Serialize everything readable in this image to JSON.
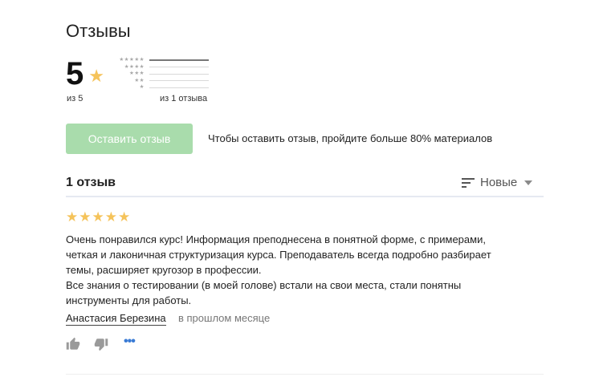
{
  "header": {
    "title": "Отзывы"
  },
  "summary": {
    "rating": "5",
    "star_glyph": "★",
    "out_of": "из 5",
    "count_text": "из 1 отзыва",
    "distribution": [
      {
        "stars": "★★★★★",
        "fraction": 1.0
      },
      {
        "stars": "★★★★",
        "fraction": 0
      },
      {
        "stars": "★★★",
        "fraction": 0
      },
      {
        "stars": "★★",
        "fraction": 0
      },
      {
        "stars": "★",
        "fraction": 0
      }
    ]
  },
  "leave_review": {
    "button_label": "Оставить отзыв",
    "hint": "Чтобы оставить отзыв, пройдите больше 80% материалов"
  },
  "reviews_header": {
    "count": "1 отзыв",
    "sort_label": "Новые"
  },
  "review": {
    "stars": "★★★★★",
    "lines": [
      "Очень понравился курс! Информация преподнесена в понятной форме, с примерами,",
      "четкая и лаконичная структуризация курса. Преподаватель всегда подробно разбирает",
      "темы, расширяет кругозор в профессии.",
      "Все знания о тестировании (в моей голове) встали на свои места, стали понятны",
      "инструменты для работы."
    ],
    "author": "Анастасия Березина",
    "date": "в прошлом месяце",
    "more_glyph": "•••"
  },
  "colors": {
    "star": "#f5c35a",
    "button_disabled": "#a9dcac",
    "link_blue": "#3a7bd5",
    "divider": "#e6e9f1"
  },
  "icons": [
    "thumbs-up-icon",
    "thumbs-down-icon",
    "more-icon",
    "sort-icon",
    "star-icon",
    "chevron-down-icon"
  ]
}
